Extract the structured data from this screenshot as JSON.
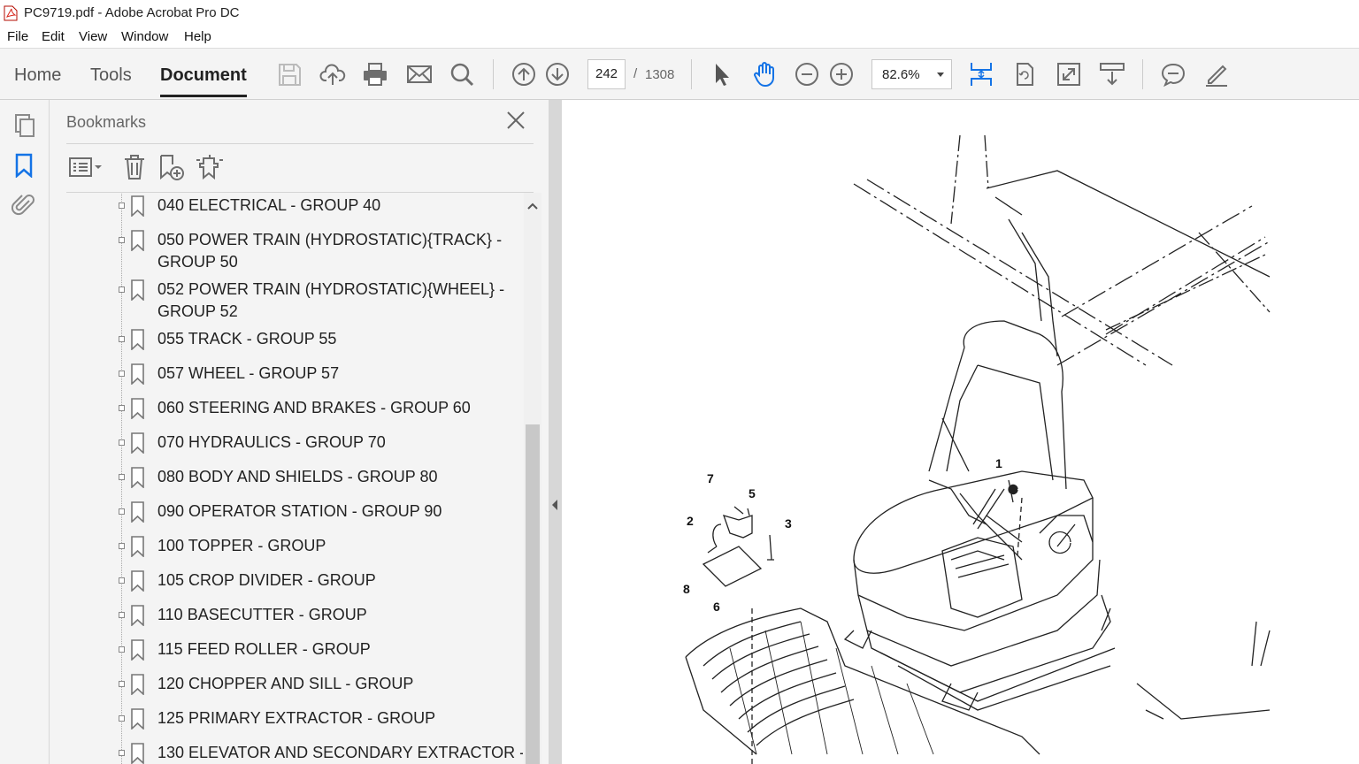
{
  "window": {
    "title": "PC9719.pdf - Adobe Acrobat Pro DC"
  },
  "menu": [
    "File",
    "Edit",
    "View",
    "Window",
    "Help"
  ],
  "tabs": {
    "home": "Home",
    "tools": "Tools",
    "document": "Document"
  },
  "nav": {
    "current_page": "242",
    "separator": "/",
    "total_pages": "1308"
  },
  "zoom": {
    "value": "82.6%"
  },
  "bookmarks": {
    "title": "Bookmarks",
    "items": [
      {
        "lines": [
          "040 ELECTRICAL - GROUP 40"
        ]
      },
      {
        "lines": [
          "050 POWER TRAIN (HYDROSTATIC){TRACK} -",
          "GROUP 50"
        ]
      },
      {
        "lines": [
          "052 POWER TRAIN (HYDROSTATIC){WHEEL} -",
          "GROUP 52"
        ]
      },
      {
        "lines": [
          "055 TRACK - GROUP 55"
        ]
      },
      {
        "lines": [
          "057 WHEEL - GROUP 57"
        ]
      },
      {
        "lines": [
          "060 STEERING AND BRAKES - GROUP 60"
        ]
      },
      {
        "lines": [
          "070 HYDRAULICS - GROUP 70"
        ]
      },
      {
        "lines": [
          "080 BODY AND SHIELDS - GROUP 80"
        ]
      },
      {
        "lines": [
          "090 OPERATOR STATION - GROUP 90"
        ]
      },
      {
        "lines": [
          "100 TOPPER - GROUP"
        ]
      },
      {
        "lines": [
          "105 CROP DIVIDER - GROUP"
        ]
      },
      {
        "lines": [
          "110 BASECUTTER - GROUP"
        ]
      },
      {
        "lines": [
          "115 FEED ROLLER - GROUP"
        ]
      },
      {
        "lines": [
          "120 CHOPPER AND SILL - GROUP"
        ]
      },
      {
        "lines": [
          "125 PRIMARY EXTRACTOR - GROUP"
        ]
      },
      {
        "lines": [
          "130 ELEVATOR AND SECONDARY EXTRACTOR -"
        ]
      }
    ]
  },
  "diagram": {
    "callouts": [
      "1",
      "2",
      "3",
      "5",
      "6",
      "7",
      "8"
    ]
  },
  "colors": {
    "accent_blue": "#1473e6",
    "toolbar_bg": "#f4f4f4",
    "icon_gray": "#6e6e6e"
  }
}
